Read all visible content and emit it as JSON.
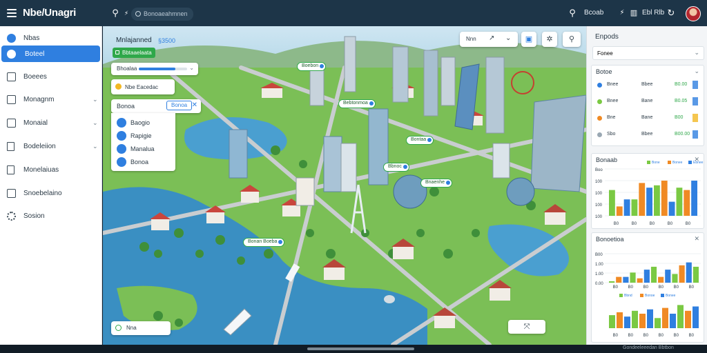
{
  "app": {
    "title": "Nbe/Unagri",
    "search_placeholder": "Bonoaeahmnen",
    "header_text_1": "Bcoab",
    "header_text_2": "Ebl Rlb"
  },
  "sidebar": {
    "items": [
      {
        "label": "Nbas",
        "icon": "dot-icon"
      },
      {
        "label": "Boteel",
        "icon": "circle-icon"
      },
      {
        "label": "Boeees",
        "icon": "box-icon"
      },
      {
        "label": "Monagnm",
        "icon": "list-icon",
        "chevron": "⌄"
      },
      {
        "label": "Monaial",
        "icon": "map-icon",
        "chevron": "⌄"
      },
      {
        "label": "Bodeleiion",
        "icon": "building-icon",
        "chevron": "⌄"
      },
      {
        "label": "Monelaiuas",
        "icon": "file-icon"
      },
      {
        "label": "Snoebelaino",
        "icon": "card-icon"
      },
      {
        "label": "Sosion",
        "icon": "gear-icon"
      }
    ]
  },
  "map": {
    "header_title": "Mnlajanned",
    "header_value": "§3500",
    "green_button": "Bbtaaelaata",
    "progress_label": "Bhoalaa",
    "progress_fraction": 0.75,
    "filter_label": "Nbe Eacedac",
    "dropdown_title": "Bonoa",
    "dropdown_badge": "Bonoa",
    "dropdown_items": [
      "Baogio",
      "Rapigie",
      "Manalua",
      "Bonoa"
    ],
    "top_controls": {
      "label": "Nnn"
    },
    "bottom_left_label": "Nna",
    "pins": [
      "Boebon",
      "Bebtonmoa",
      "Bontaa",
      "Bbnoc",
      "Bnaenhe",
      "Bonan Boeba"
    ]
  },
  "rpanel": {
    "cards": [
      {
        "title": "Enpods",
        "dropdown": "Fonee"
      },
      {
        "title": "Botoe"
      },
      {
        "title": "Bonaab"
      },
      {
        "title": "Bonoetioa"
      }
    ],
    "stat_rows": [
      {
        "name": "Bnee",
        "v1": "Bbee",
        "v2": "B0.00"
      },
      {
        "name": "Bnee",
        "v1": "Bane",
        "v2": "B0.05"
      },
      {
        "name": "Bne",
        "v1": "Bane",
        "v2": "B00"
      },
      {
        "name": "Sbo",
        "v1": "Bbee",
        "v2": "B00.00"
      }
    ],
    "chart1": {
      "ticks": [
        "Boo",
        "100",
        "100",
        "100",
        "100"
      ],
      "xlabels": [
        "B0",
        "B0",
        "B0",
        "B0",
        "B0"
      ],
      "legend": [
        "Bone",
        "Bonee",
        "Ebnee"
      ],
      "bars": [
        0.55,
        0.2,
        0.35,
        0.35,
        0.7,
        0.6,
        0.65,
        0.75,
        0.3,
        0.6,
        0.55,
        0.75
      ]
    },
    "chart2": {
      "ticks": [
        "B00",
        "1.00",
        "1.00",
        "0.00"
      ],
      "xlabels": [
        "B0",
        "B0",
        "B0",
        "B0",
        "B0",
        "B0"
      ],
      "bars": [
        0.05,
        0.2,
        0.2,
        0.35,
        0.15,
        0.45,
        0.55,
        0.2,
        0.45,
        0.3,
        0.6,
        0.7,
        0.55
      ]
    },
    "chart3": {
      "legend": [
        "Bbnd",
        "Bonoe",
        "Bonee"
      ],
      "bars": [
        0.45,
        0.55,
        0.4,
        0.6,
        0.5,
        0.65,
        0.35,
        0.7,
        0.5,
        0.8,
        0.6,
        0.75
      ]
    }
  },
  "bottom": {
    "right_text": "Gondeeleeedan  Bbtbon"
  },
  "colors": {
    "topbar": "#1d3548",
    "accent": "#2f7fe0",
    "water": "#3a8fc2",
    "grass": "#7bbf56",
    "bar_green": "#7ac943",
    "bar_orange": "#f08a24",
    "bar_blue": "#2f7fe0"
  }
}
